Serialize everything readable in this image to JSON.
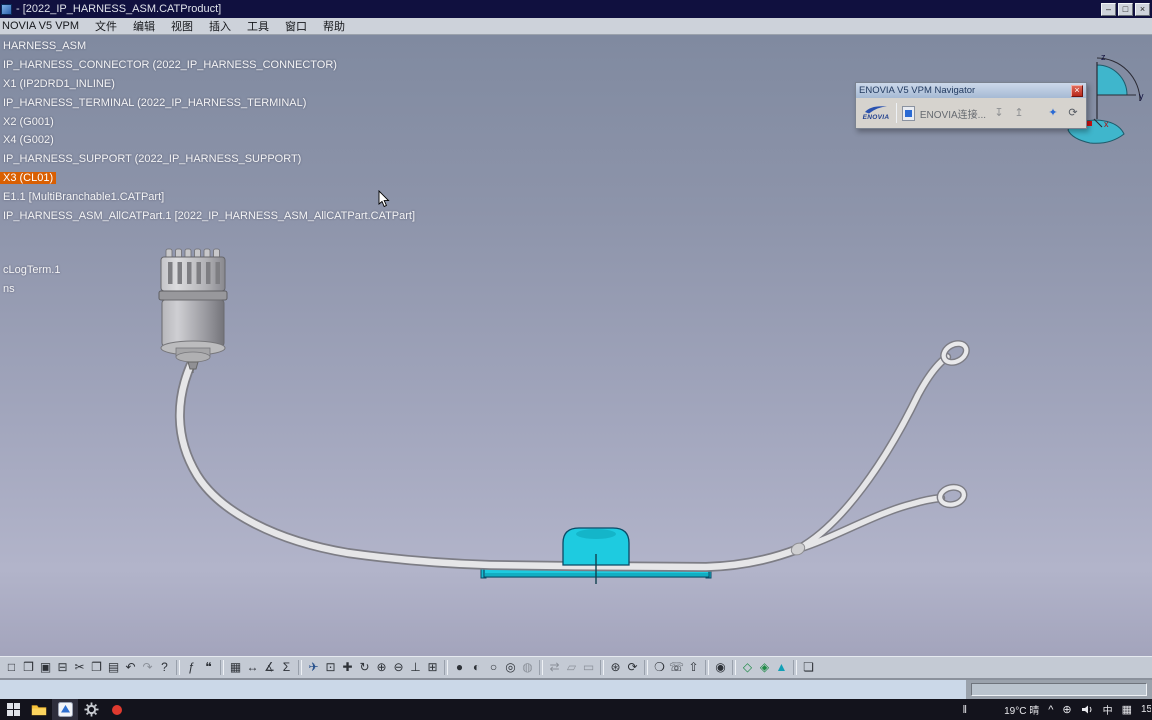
{
  "window": {
    "title": "- [2022_IP_HARNESS_ASM.CATProduct]",
    "minimize": "–",
    "restore": "□",
    "close": "×"
  },
  "menubar": {
    "items": [
      {
        "label": "NOVIA V5 VPM"
      },
      {
        "label": "文件"
      },
      {
        "label": "编辑"
      },
      {
        "label": "视图"
      },
      {
        "label": "插入"
      },
      {
        "label": "工具"
      },
      {
        "label": "窗口"
      },
      {
        "label": "帮助"
      }
    ]
  },
  "tree": {
    "items": [
      {
        "label": "HARNESS_ASM",
        "selected": false
      },
      {
        "label": "IP_HARNESS_CONNECTOR (2022_IP_HARNESS_CONNECTOR)",
        "selected": false
      },
      {
        "label": "X1 (IP2DRD1_INLINE)",
        "selected": false
      },
      {
        "label": "IP_HARNESS_TERMINAL (2022_IP_HARNESS_TERMINAL)",
        "selected": false
      },
      {
        "label": "X2 (G001)",
        "selected": false
      },
      {
        "label": "X4 (G002)",
        "selected": false
      },
      {
        "label": "IP_HARNESS_SUPPORT (2022_IP_HARNESS_SUPPORT)",
        "selected": false
      },
      {
        "label": "X3 (CL01)",
        "selected": true
      },
      {
        "label": "E1.1 [MultiBranchable1.CATPart]",
        "selected": false
      },
      {
        "label": "IP_HARNESS_ASM_AllCATPart.1 [2022_IP_HARNESS_ASM_AllCATPart.CATPart]",
        "selected": false
      }
    ],
    "lower_items": [
      {
        "label": "cLogTerm.1"
      },
      {
        "label": "ns"
      }
    ]
  },
  "navigator": {
    "title": "ENOVIA V5 VPM Navigator",
    "close": "×",
    "brand": "ENOVIA",
    "connect_label": "ENOVIA连接...",
    "icons": [
      {
        "name": "load-icon",
        "glyph": "↧"
      },
      {
        "name": "unload-icon",
        "glyph": "↥"
      },
      {
        "name": "sync-icon",
        "glyph": "✦"
      },
      {
        "name": "refresh-icon",
        "glyph": "⟳"
      }
    ]
  },
  "compass": {
    "z": "z",
    "y": "y",
    "x": "x"
  },
  "toolbar": {
    "icons": [
      {
        "name": "new-document",
        "glyph": "□"
      },
      {
        "name": "open-document",
        "glyph": "❒"
      },
      {
        "name": "save",
        "glyph": "▣"
      },
      {
        "name": "print",
        "glyph": "⊟"
      },
      {
        "name": "cut",
        "glyph": "✂"
      },
      {
        "name": "copy",
        "glyph": "❐"
      },
      {
        "name": "paste",
        "glyph": "▤"
      },
      {
        "name": "undo",
        "glyph": "↶"
      },
      {
        "name": "redo",
        "glyph": "↷",
        "disabled": true
      },
      {
        "name": "context-help",
        "glyph": "?"
      },
      {
        "name": "separator",
        "glyph": ""
      },
      {
        "name": "formula-fx",
        "glyph": "ƒ"
      },
      {
        "name": "comment",
        "glyph": "❝"
      },
      {
        "name": "separator",
        "glyph": ""
      },
      {
        "name": "design-table",
        "glyph": "▦"
      },
      {
        "name": "measure-between",
        "glyph": "↔"
      },
      {
        "name": "measure-item",
        "glyph": "∡"
      },
      {
        "name": "mass-properties",
        "glyph": "Σ"
      },
      {
        "name": "separator",
        "glyph": ""
      },
      {
        "name": "fly-mode",
        "glyph": "✈",
        "style": "color:#27508c"
      },
      {
        "name": "fit-all-in",
        "glyph": "⊡"
      },
      {
        "name": "pan",
        "glyph": "✚"
      },
      {
        "name": "rotate",
        "glyph": "↻"
      },
      {
        "name": "zoom-in",
        "glyph": "⊕"
      },
      {
        "name": "zoom-out",
        "glyph": "⊖"
      },
      {
        "name": "normal-view",
        "glyph": "⊥"
      },
      {
        "name": "create-multi-view",
        "glyph": "⊞"
      },
      {
        "name": "separator",
        "glyph": ""
      },
      {
        "name": "shaded-render",
        "glyph": "●"
      },
      {
        "name": "shaded-with-edges",
        "glyph": "◐"
      },
      {
        "name": "wireframe-render",
        "glyph": "○"
      },
      {
        "name": "hide-show",
        "glyph": "◎"
      },
      {
        "name": "swap-visible-space",
        "glyph": "◍",
        "disabled": true
      },
      {
        "name": "separator",
        "glyph": ""
      },
      {
        "name": "exchange-view",
        "glyph": "⇄",
        "disabled": true
      },
      {
        "name": "near-clipping",
        "glyph": "▱",
        "disabled": true
      },
      {
        "name": "far-clipping",
        "glyph": "▭",
        "disabled": true
      },
      {
        "name": "separator",
        "glyph": ""
      },
      {
        "name": "web-browser",
        "glyph": "⊛"
      },
      {
        "name": "refresh-web",
        "glyph": "⟳"
      },
      {
        "name": "separator",
        "glyph": ""
      },
      {
        "name": "catalog-browser",
        "glyph": "❍"
      },
      {
        "name": "vpm-connect",
        "glyph": "☏"
      },
      {
        "name": "publish",
        "glyph": "⇧"
      },
      {
        "name": "separator",
        "glyph": ""
      },
      {
        "name": "record-macro",
        "glyph": "◉"
      },
      {
        "name": "separator",
        "glyph": ""
      },
      {
        "name": "structure-node-open",
        "glyph": "◇",
        "style": "color:#1e8a46"
      },
      {
        "name": "structure-node-closed",
        "glyph": "◈",
        "style": "color:#1e8a46"
      },
      {
        "name": "upload-to-vpm",
        "glyph": "▲",
        "style": "color:#12a0b6"
      },
      {
        "name": "separator",
        "glyph": ""
      },
      {
        "name": "tile-windows",
        "glyph": "❏"
      }
    ]
  },
  "statusbar": {
    "message": ""
  },
  "taskbar": {
    "pause": "‖",
    "weather": "19°C 晴",
    "tray_expand": "^",
    "network": "⊕",
    "ime": "中",
    "keyboard": "▦",
    "time": "15"
  },
  "colors": {
    "selection_orange": "#d95f02",
    "harness_clip_cyan": "#1ecbe0",
    "cable_gray": "#e4e4e6",
    "titlebar_navy": "#10103f",
    "viewport_top": "#808aa0",
    "viewport_bottom": "#a3a4bc"
  }
}
